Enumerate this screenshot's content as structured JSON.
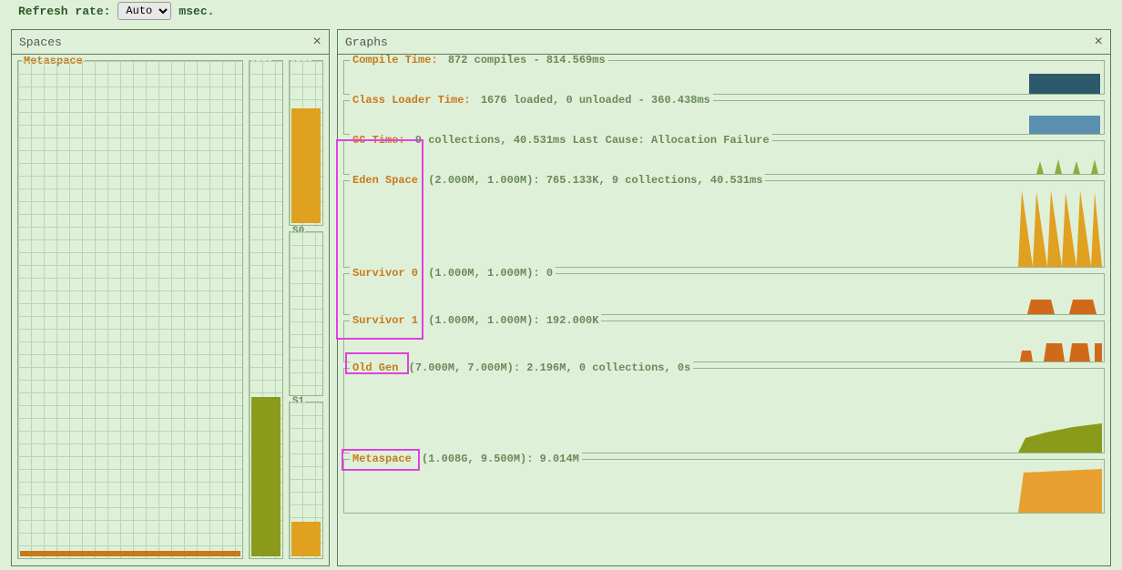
{
  "toolbar": {
    "refresh_label": "Refresh rate:",
    "auto_option": "Auto",
    "unit": "msec."
  },
  "panels": {
    "spaces": {
      "title": "Spaces"
    },
    "graphs": {
      "title": "Graphs"
    }
  },
  "spaces": {
    "metaspace_label": "Metaspace",
    "dots1": "...",
    "dots2": "...",
    "s0": "S0",
    "s1": "S1"
  },
  "graphs": {
    "compile": {
      "name": "Compile Time:",
      "detail": "872 compiles - 814.569ms"
    },
    "clsloader": {
      "name": "Class Loader Time:",
      "detail": "1676 loaded, 0 unloaded - 360.438ms"
    },
    "gc": {
      "name": "GC Time:",
      "detail": "9 collections, 40.531ms Last Cause: Allocation Failure"
    },
    "eden": {
      "name": "Eden Space",
      "detail": "(2.000M, 1.000M): 765.133K, 9 collections, 40.531ms"
    },
    "s0g": {
      "name": "Survivor 0",
      "detail": "(1.000M, 1.000M): 0"
    },
    "s1g": {
      "name": "Survivor 1",
      "detail": "(1.000M, 1.000M): 192.000K"
    },
    "old": {
      "name": "Old Gen",
      "detail": "(7.000M, 7.000M): 2.196M, 0 collections, 0s"
    },
    "metag": {
      "name": "Metaspace",
      "detail": "(1.008G, 9.500M): 9.014M"
    }
  },
  "chart_data": [
    {
      "type": "bar",
      "name": "Compile Time",
      "color": "#2c5a6b",
      "bars": [
        0,
        0,
        0,
        0.9
      ]
    },
    {
      "type": "bar",
      "name": "Class Loader Time",
      "color": "#5a8fb0",
      "bars": [
        0,
        0,
        0,
        0.85
      ]
    },
    {
      "type": "bar",
      "name": "GC Time",
      "color": "#8ab03a",
      "bars": [
        0.5,
        0.55,
        0.5,
        0.55
      ]
    },
    {
      "type": "area",
      "name": "Eden Space",
      "color": "#e0a020",
      "spikes": [
        0.95,
        0.9,
        0.92,
        0.95,
        0.9,
        0.95,
        0.9
      ]
    },
    {
      "type": "bar",
      "name": "Survivor 0",
      "color": "#d06a1a",
      "bars": [
        0.5,
        0.5
      ]
    },
    {
      "type": "bar",
      "name": "Survivor 1",
      "color": "#d06a1a",
      "bars": [
        0.4,
        0.5,
        0.5,
        0.5
      ]
    },
    {
      "type": "area",
      "name": "Old Gen",
      "color": "#8a9a1a",
      "points": [
        0.25,
        0.3,
        0.35,
        0.4
      ]
    },
    {
      "type": "area",
      "name": "Metaspace",
      "color": "#e8a030",
      "points": [
        0.85,
        0.87,
        0.9,
        0.93
      ]
    }
  ],
  "colors": {
    "orange": "#e0a020",
    "olive": "#8a9a1a",
    "darkorange": "#d06a1a"
  }
}
